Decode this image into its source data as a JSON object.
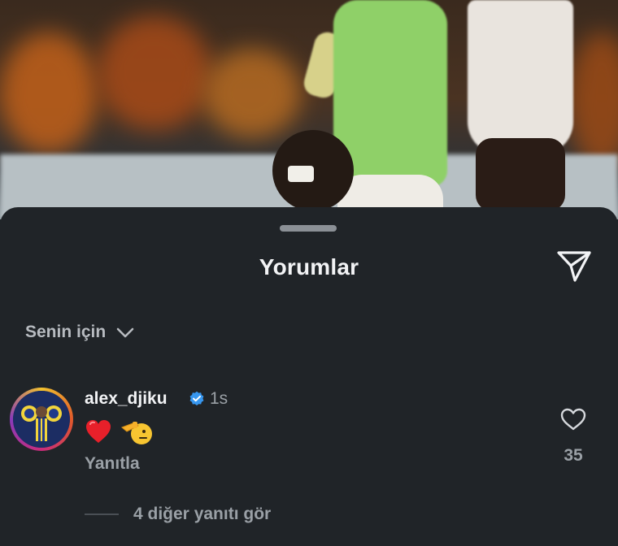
{
  "sheet": {
    "title": "Yorumlar",
    "filter_label": "Senin için"
  },
  "comment": {
    "username": "alex_djiku",
    "time": "1s",
    "content_emojis": [
      "❤️",
      "🫡"
    ],
    "reply_label": "Yanıtla",
    "like_count": "35",
    "more_replies": "4 diğer yanıtı gör"
  },
  "icons": {
    "share": "send-icon",
    "filter": "chevron-down-icon",
    "like": "heart-outline-icon",
    "verified": "verified-badge-icon"
  },
  "colors": {
    "sheet_bg": "#202428",
    "text_primary": "#f2f3f5",
    "text_secondary": "#9aa0a6",
    "verified_blue": "#3797f0"
  }
}
